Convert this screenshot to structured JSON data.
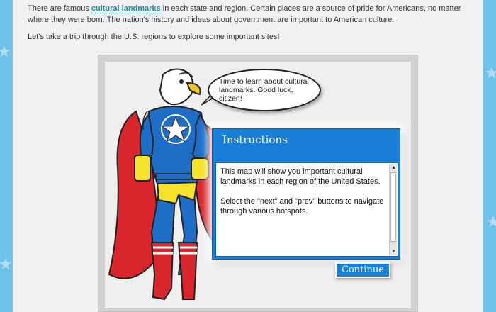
{
  "intro": {
    "p1_before": "There are famous ",
    "p1_link": "cultural landmarks",
    "p1_after": " in each state and region. Certain places are a source of pride for Americans, no matter where they were born. The nation's history and ideas about government are important to American culture.",
    "p2": "Let's take a trip through the U.S. regions to explore some important sites!"
  },
  "speech_bubble": {
    "text": "Time to learn about cultural landmarks. Good luck, citizen!"
  },
  "instructions": {
    "title": "Instructions",
    "para1": "This map will show you important cultural landmarks in each region of the United States.",
    "para2": "Select the \"next\" and \"prev\" buttons to navigate through various hotspots.",
    "continue_label": "Continue"
  },
  "colors": {
    "accent_blue": "#1a7fd8",
    "link_teal": "#1f8ea6",
    "side_background": "#6fc3ea"
  },
  "icons": {
    "scroll_up": "▲",
    "scroll_down": "▼"
  }
}
